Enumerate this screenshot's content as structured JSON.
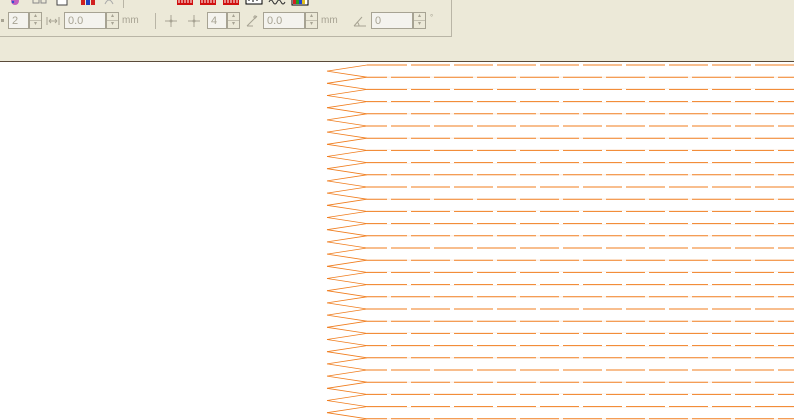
{
  "toolbar": {
    "spacing_field": {
      "value": "2"
    },
    "offset_field": {
      "value": "0.0",
      "unit": "mm"
    },
    "repeat_field": {
      "value": "4"
    },
    "length_field": {
      "value": "0.0",
      "unit": "mm"
    },
    "angle_field": {
      "value": "0",
      "unit": "°"
    }
  },
  "colors": {
    "toolbar_bg": "#ece9d8",
    "stitch_orange": "#f07d1e",
    "stitch_fill": "#fdeed9",
    "disabled_text": "#a7a393"
  },
  "icons": [
    "palette-icon",
    "grid-icon",
    "window-icon",
    "text-icon",
    "red-pattern-icon",
    "ruler-icon",
    "wave-icon",
    "color-chart-icon",
    "move-arrows-icon",
    "move-arrows-alt-icon",
    "angle-stitch-icon",
    "rotate-angle-icon"
  ]
}
